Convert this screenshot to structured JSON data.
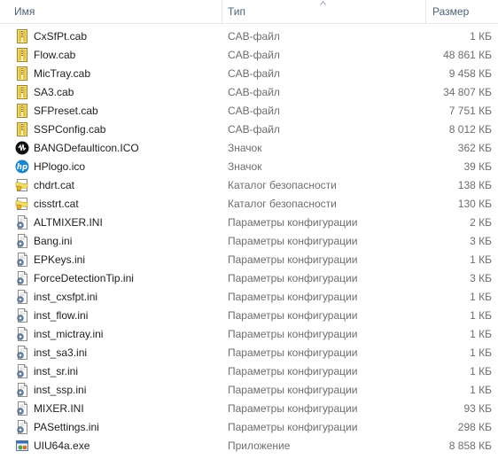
{
  "columns": {
    "name": "Имя",
    "type": "Тип",
    "size": "Размер"
  },
  "files": [
    {
      "name": "CxSfPt.cab",
      "type": "CAB-файл",
      "size": "1 КБ",
      "icon": "cab-archive-icon"
    },
    {
      "name": "Flow.cab",
      "type": "CAB-файл",
      "size": "48 861 КБ",
      "icon": "cab-archive-icon"
    },
    {
      "name": "MicTray.cab",
      "type": "CAB-файл",
      "size": "9 458 КБ",
      "icon": "cab-archive-icon"
    },
    {
      "name": "SA3.cab",
      "type": "CAB-файл",
      "size": "34 807 КБ",
      "icon": "cab-archive-icon"
    },
    {
      "name": "SFPreset.cab",
      "type": "CAB-файл",
      "size": "7 751 КБ",
      "icon": "cab-archive-icon"
    },
    {
      "name": "SSPConfig.cab",
      "type": "CAB-файл",
      "size": "8 012 КБ",
      "icon": "cab-archive-icon"
    },
    {
      "name": "BANGDefaulticon.ICO",
      "type": "Значок",
      "size": "362 КБ",
      "icon": "bang-audio-icon"
    },
    {
      "name": "HPlogo.ico",
      "type": "Значок",
      "size": "39 КБ",
      "icon": "hp-logo-icon"
    },
    {
      "name": "chdrt.cat",
      "type": "Каталог безопасности",
      "size": "138 КБ",
      "icon": "security-catalog-icon"
    },
    {
      "name": "cisstrt.cat",
      "type": "Каталог безопасности",
      "size": "130 КБ",
      "icon": "security-catalog-icon"
    },
    {
      "name": "ALTMIXER.INI",
      "type": "Параметры конфигурации",
      "size": "2 КБ",
      "icon": "config-settings-icon"
    },
    {
      "name": "Bang.ini",
      "type": "Параметры конфигурации",
      "size": "3 КБ",
      "icon": "config-settings-icon"
    },
    {
      "name": "EPKeys.ini",
      "type": "Параметры конфигурации",
      "size": "1 КБ",
      "icon": "config-settings-icon"
    },
    {
      "name": "ForceDetectionTip.ini",
      "type": "Параметры конфигурации",
      "size": "3 КБ",
      "icon": "config-settings-icon"
    },
    {
      "name": "inst_cxsfpt.ini",
      "type": "Параметры конфигурации",
      "size": "1 КБ",
      "icon": "config-settings-icon"
    },
    {
      "name": "inst_flow.ini",
      "type": "Параметры конфигурации",
      "size": "1 КБ",
      "icon": "config-settings-icon"
    },
    {
      "name": "inst_mictray.ini",
      "type": "Параметры конфигурации",
      "size": "1 КБ",
      "icon": "config-settings-icon"
    },
    {
      "name": "inst_sa3.ini",
      "type": "Параметры конфигурации",
      "size": "1 КБ",
      "icon": "config-settings-icon"
    },
    {
      "name": "inst_sr.ini",
      "type": "Параметры конфигурации",
      "size": "1 КБ",
      "icon": "config-settings-icon"
    },
    {
      "name": "inst_ssp.ini",
      "type": "Параметры конфигурации",
      "size": "1 КБ",
      "icon": "config-settings-icon"
    },
    {
      "name": "MIXER.INI",
      "type": "Параметры конфигурации",
      "size": "93 КБ",
      "icon": "config-settings-icon"
    },
    {
      "name": "PASettings.ini",
      "type": "Параметры конфигурации",
      "size": "298 КБ",
      "icon": "config-settings-icon"
    },
    {
      "name": "UIU64a.exe",
      "type": "Приложение",
      "size": "8 858 КБ",
      "icon": "application-exe-icon"
    }
  ],
  "colors": {
    "header_text": "#4c607a",
    "name_text": "#1e1e1e",
    "detail_text": "#6d6d6d",
    "cab_icon": "#e8c23a",
    "catalog_icon": "#f2dc6a",
    "hp_icon": "#1a86d0"
  }
}
